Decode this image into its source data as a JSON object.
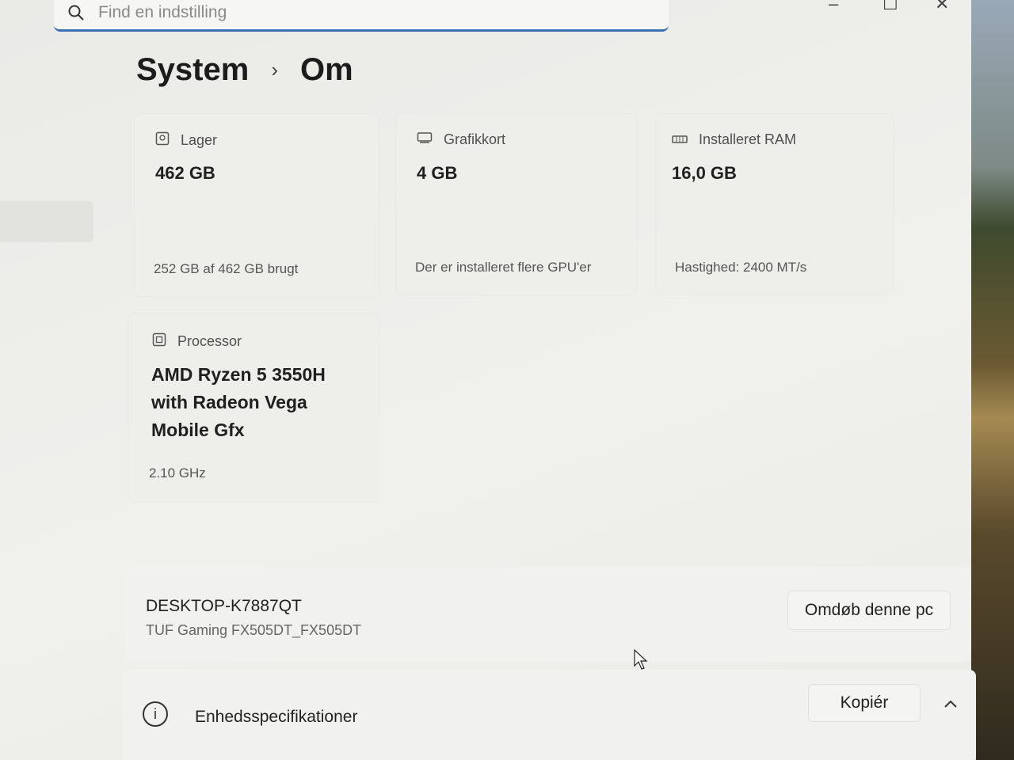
{
  "search": {
    "placeholder": "Find en indstilling"
  },
  "window_controls": {
    "minimize": "–",
    "maximize": "☐",
    "close": "✕"
  },
  "breadcrumb": {
    "parent": "System",
    "current": "Om"
  },
  "specs": {
    "storage": {
      "label": "Lager",
      "value": "462 GB",
      "detail": "252 GB af 462 GB brugt",
      "icon": "storage-icon"
    },
    "graphics": {
      "label": "Grafikkort",
      "value": "4 GB",
      "detail": "Der er installeret flere GPU'er",
      "icon": "gpu-icon"
    },
    "ram": {
      "label": "Installeret RAM",
      "value": "16,0 GB",
      "detail": "Hastighed: 2400 MT/s",
      "icon": "ram-icon"
    },
    "processor": {
      "label": "Processor",
      "line1": "AMD Ryzen 5 3550H",
      "line2": "with Radeon Vega",
      "line3": "Mobile Gfx",
      "detail": "2.10 GHz",
      "icon": "processor-icon"
    }
  },
  "device": {
    "name": "DESKTOP-K7887QT",
    "model": "TUF Gaming FX505DT_FX505DT",
    "rename_label": "Omdøb denne pc"
  },
  "device_specs": {
    "label": "Enhedsspecifikationer",
    "copy_label": "Kopiér",
    "icon": "info-icon"
  }
}
